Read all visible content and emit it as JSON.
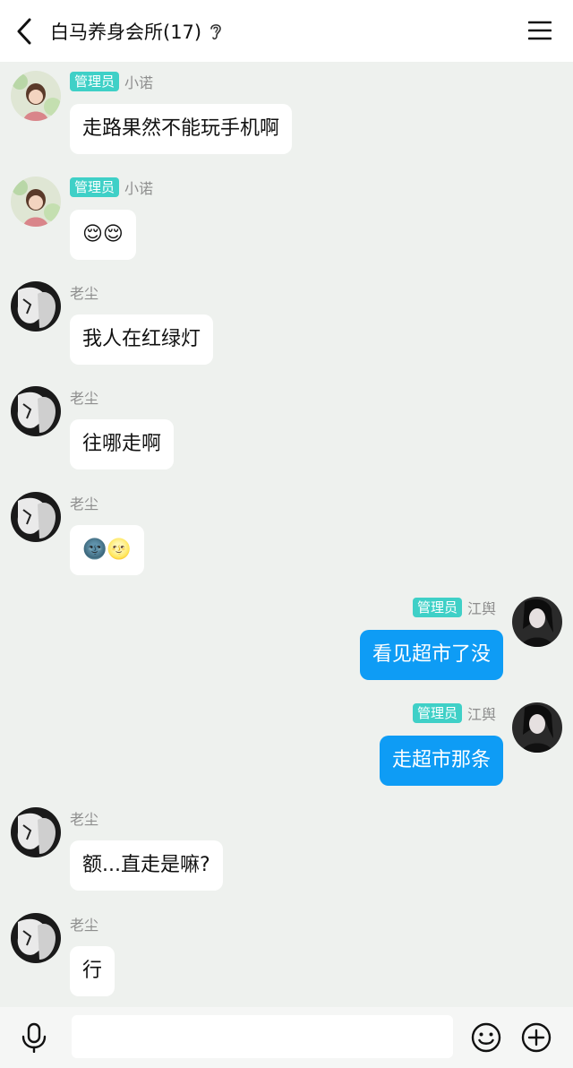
{
  "header": {
    "title": "白马养身会所(17)",
    "back_icon": "chevron-left-icon",
    "ear_icon": "ear-icon",
    "menu_icon": "menu-icon"
  },
  "messages": [
    {
      "sender": "小诺",
      "badge": "管理员",
      "text": "走路果然不能玩手机啊",
      "mine": false
    },
    {
      "sender": "小诺",
      "badge": "管理员",
      "text": "😌😌",
      "mine": false
    },
    {
      "sender": "老尘",
      "badge": "",
      "text": "我人在红绿灯",
      "mine": false
    },
    {
      "sender": "老尘",
      "badge": "",
      "text": "往哪走啊",
      "mine": false
    },
    {
      "sender": "老尘",
      "badge": "",
      "text": "🌚🌝",
      "mine": false
    },
    {
      "sender": "江舆",
      "badge": "管理员",
      "text": "看见超市了没",
      "mine": true
    },
    {
      "sender": "江舆",
      "badge": "管理员",
      "text": "走超市那条",
      "mine": true
    },
    {
      "sender": "老尘",
      "badge": "",
      "text": "额...直走是嘛?",
      "mine": false
    },
    {
      "sender": "老尘",
      "badge": "",
      "text": "行",
      "mine": false
    }
  ],
  "bottom": {
    "input_value": "",
    "mic_icon": "microphone-icon",
    "emoji_icon": "emoji-icon",
    "plus_icon": "plus-circle-icon"
  },
  "colors": {
    "background": "#eef1ee",
    "admin_badge": "#3fd0c7",
    "my_bubble": "#0e9cf5"
  }
}
